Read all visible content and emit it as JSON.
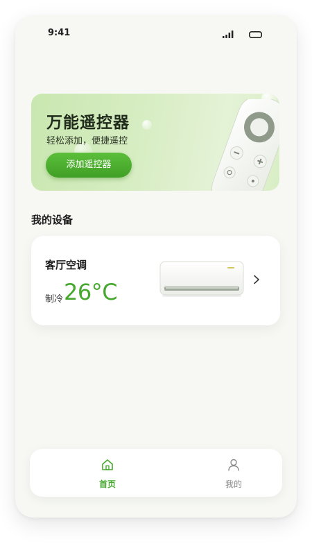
{
  "status_bar": {
    "time": "9:41"
  },
  "banner": {
    "title": "万能遥控器",
    "subtitle": "轻松添加，便捷遥控",
    "button_label": "添加遥控器"
  },
  "devices_section": {
    "title": "我的设备"
  },
  "device": {
    "name": "客厅空调",
    "mode": "制冷",
    "temperature": "26°C"
  },
  "bottom_nav": {
    "items": [
      {
        "label": "首页",
        "icon": "home-icon",
        "active": true
      },
      {
        "label": "我的",
        "icon": "user-icon",
        "active": false
      }
    ]
  },
  "colors": {
    "accent": "#46a82e",
    "button": "#4caf32",
    "banner_bg": "#d3ebbd",
    "page_bg": "#f7f8f4"
  }
}
